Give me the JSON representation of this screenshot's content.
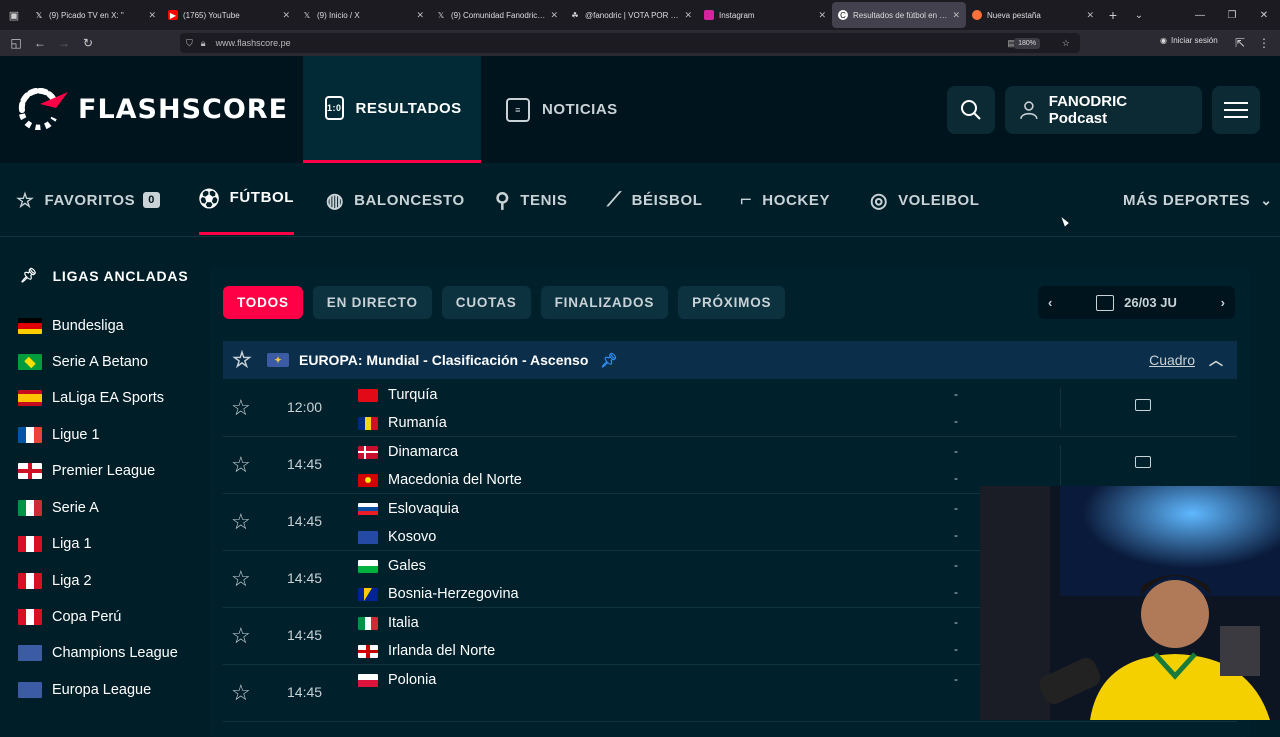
{
  "browser": {
    "tabs": [
      {
        "label": "(9) Picado TV en X: \"",
        "icon": "x-icon",
        "active": false
      },
      {
        "label": "(1765) YouTube",
        "icon": "youtube-icon",
        "active": false
      },
      {
        "label": "(9) Inicio / X",
        "icon": "x-icon",
        "active": false
      },
      {
        "label": "(9) Comunidad Fanodric Ar",
        "icon": "x-icon",
        "active": false
      },
      {
        "label": "@fanodric | VOTA POR TU",
        "icon": "generic-icon",
        "active": false
      },
      {
        "label": "Instagram",
        "icon": "instagram-icon",
        "active": false
      },
      {
        "label": "Resultados de fútbol en viv",
        "icon": "flashscore-icon",
        "active": true
      },
      {
        "label": "Nueva pestaña",
        "icon": "firefox-icon",
        "active": false
      }
    ],
    "url": "www.flashscore.pe",
    "zoom": "180%",
    "signin": "Iniciar sesión"
  },
  "header": {
    "logo": "FLASHSCORE",
    "nav_results": "RESULTADOS",
    "nav_news": "NOTICIAS",
    "user_name": "FANODRIC Podcast"
  },
  "sports": {
    "favorites_label": "FAVORITOS",
    "favorites_count": "0",
    "items": [
      "FÚTBOL",
      "BALONCESTO",
      "TENIS",
      "BÉISBOL",
      "HOCKEY",
      "VOLEIBOL"
    ],
    "more": "MÁS DEPORTES"
  },
  "sidebar": {
    "title": "LIGAS ANCLADAS",
    "leagues": [
      {
        "name": "Bundesliga",
        "flag": "germany"
      },
      {
        "name": "Serie A Betano",
        "flag": "brazil"
      },
      {
        "name": "LaLiga EA Sports",
        "flag": "spain"
      },
      {
        "name": "Ligue 1",
        "flag": "france"
      },
      {
        "name": "Premier League",
        "flag": "england"
      },
      {
        "name": "Serie A",
        "flag": "italy"
      },
      {
        "name": "Liga 1",
        "flag": "peru"
      },
      {
        "name": "Liga 2",
        "flag": "peru"
      },
      {
        "name": "Copa Perú",
        "flag": "peru"
      },
      {
        "name": "Champions League",
        "flag": "world"
      },
      {
        "name": "Europa League",
        "flag": "world"
      }
    ]
  },
  "filters": {
    "items": [
      "TODOS",
      "EN DIRECTO",
      "CUOTAS",
      "FINALIZADOS",
      "PRÓXIMOS"
    ],
    "active": "TODOS",
    "date": "26/03 JU"
  },
  "competition": {
    "name": "EUROPA: Mundial - Clasificación - Ascenso",
    "cuadro": "Cuadro"
  },
  "matches": [
    {
      "time": "12:00",
      "home": "Turquía",
      "away": "Rumanía",
      "home_score": "-",
      "away_score": "-",
      "tv": true
    },
    {
      "time": "14:45",
      "home": "Dinamarca",
      "away": "Macedonia del Norte",
      "home_score": "-",
      "away_score": "-",
      "tv": true
    },
    {
      "time": "14:45",
      "home": "Eslovaquia",
      "away": "Kosovo",
      "home_score": "-",
      "away_score": "-",
      "tv": false
    },
    {
      "time": "14:45",
      "home": "Gales",
      "away": "Bosnia-Herzegovina",
      "home_score": "-",
      "away_score": "-",
      "tv": false
    },
    {
      "time": "14:45",
      "home": "Italia",
      "away": "Irlanda del Norte",
      "home_score": "-",
      "away_score": "-",
      "tv": false
    },
    {
      "time": "14:45",
      "home": "Polonia",
      "away": "",
      "home_score": "-",
      "away_score": "",
      "tv": false
    }
  ],
  "colors": {
    "accent": "#ff0046",
    "header_bg": "#00141e",
    "page_bg": "#001e28"
  }
}
